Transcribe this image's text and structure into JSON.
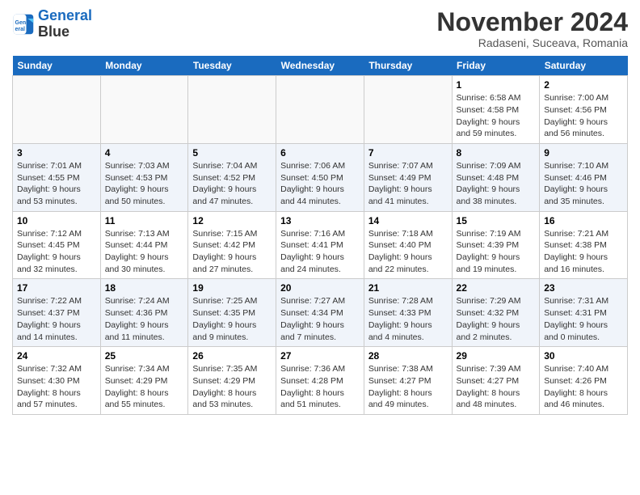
{
  "logo": {
    "line1": "General",
    "line2": "Blue"
  },
  "title": "November 2024",
  "subtitle": "Radaseni, Suceava, Romania",
  "days_of_week": [
    "Sunday",
    "Monday",
    "Tuesday",
    "Wednesday",
    "Thursday",
    "Friday",
    "Saturday"
  ],
  "weeks": [
    [
      {
        "day": "",
        "info": ""
      },
      {
        "day": "",
        "info": ""
      },
      {
        "day": "",
        "info": ""
      },
      {
        "day": "",
        "info": ""
      },
      {
        "day": "",
        "info": ""
      },
      {
        "day": "1",
        "info": "Sunrise: 6:58 AM\nSunset: 4:58 PM\nDaylight: 9 hours and 59 minutes."
      },
      {
        "day": "2",
        "info": "Sunrise: 7:00 AM\nSunset: 4:56 PM\nDaylight: 9 hours and 56 minutes."
      }
    ],
    [
      {
        "day": "3",
        "info": "Sunrise: 7:01 AM\nSunset: 4:55 PM\nDaylight: 9 hours and 53 minutes."
      },
      {
        "day": "4",
        "info": "Sunrise: 7:03 AM\nSunset: 4:53 PM\nDaylight: 9 hours and 50 minutes."
      },
      {
        "day": "5",
        "info": "Sunrise: 7:04 AM\nSunset: 4:52 PM\nDaylight: 9 hours and 47 minutes."
      },
      {
        "day": "6",
        "info": "Sunrise: 7:06 AM\nSunset: 4:50 PM\nDaylight: 9 hours and 44 minutes."
      },
      {
        "day": "7",
        "info": "Sunrise: 7:07 AM\nSunset: 4:49 PM\nDaylight: 9 hours and 41 minutes."
      },
      {
        "day": "8",
        "info": "Sunrise: 7:09 AM\nSunset: 4:48 PM\nDaylight: 9 hours and 38 minutes."
      },
      {
        "day": "9",
        "info": "Sunrise: 7:10 AM\nSunset: 4:46 PM\nDaylight: 9 hours and 35 minutes."
      }
    ],
    [
      {
        "day": "10",
        "info": "Sunrise: 7:12 AM\nSunset: 4:45 PM\nDaylight: 9 hours and 32 minutes."
      },
      {
        "day": "11",
        "info": "Sunrise: 7:13 AM\nSunset: 4:44 PM\nDaylight: 9 hours and 30 minutes."
      },
      {
        "day": "12",
        "info": "Sunrise: 7:15 AM\nSunset: 4:42 PM\nDaylight: 9 hours and 27 minutes."
      },
      {
        "day": "13",
        "info": "Sunrise: 7:16 AM\nSunset: 4:41 PM\nDaylight: 9 hours and 24 minutes."
      },
      {
        "day": "14",
        "info": "Sunrise: 7:18 AM\nSunset: 4:40 PM\nDaylight: 9 hours and 22 minutes."
      },
      {
        "day": "15",
        "info": "Sunrise: 7:19 AM\nSunset: 4:39 PM\nDaylight: 9 hours and 19 minutes."
      },
      {
        "day": "16",
        "info": "Sunrise: 7:21 AM\nSunset: 4:38 PM\nDaylight: 9 hours and 16 minutes."
      }
    ],
    [
      {
        "day": "17",
        "info": "Sunrise: 7:22 AM\nSunset: 4:37 PM\nDaylight: 9 hours and 14 minutes."
      },
      {
        "day": "18",
        "info": "Sunrise: 7:24 AM\nSunset: 4:36 PM\nDaylight: 9 hours and 11 minutes."
      },
      {
        "day": "19",
        "info": "Sunrise: 7:25 AM\nSunset: 4:35 PM\nDaylight: 9 hours and 9 minutes."
      },
      {
        "day": "20",
        "info": "Sunrise: 7:27 AM\nSunset: 4:34 PM\nDaylight: 9 hours and 7 minutes."
      },
      {
        "day": "21",
        "info": "Sunrise: 7:28 AM\nSunset: 4:33 PM\nDaylight: 9 hours and 4 minutes."
      },
      {
        "day": "22",
        "info": "Sunrise: 7:29 AM\nSunset: 4:32 PM\nDaylight: 9 hours and 2 minutes."
      },
      {
        "day": "23",
        "info": "Sunrise: 7:31 AM\nSunset: 4:31 PM\nDaylight: 9 hours and 0 minutes."
      }
    ],
    [
      {
        "day": "24",
        "info": "Sunrise: 7:32 AM\nSunset: 4:30 PM\nDaylight: 8 hours and 57 minutes."
      },
      {
        "day": "25",
        "info": "Sunrise: 7:34 AM\nSunset: 4:29 PM\nDaylight: 8 hours and 55 minutes."
      },
      {
        "day": "26",
        "info": "Sunrise: 7:35 AM\nSunset: 4:29 PM\nDaylight: 8 hours and 53 minutes."
      },
      {
        "day": "27",
        "info": "Sunrise: 7:36 AM\nSunset: 4:28 PM\nDaylight: 8 hours and 51 minutes."
      },
      {
        "day": "28",
        "info": "Sunrise: 7:38 AM\nSunset: 4:27 PM\nDaylight: 8 hours and 49 minutes."
      },
      {
        "day": "29",
        "info": "Sunrise: 7:39 AM\nSunset: 4:27 PM\nDaylight: 8 hours and 48 minutes."
      },
      {
        "day": "30",
        "info": "Sunrise: 7:40 AM\nSunset: 4:26 PM\nDaylight: 8 hours and 46 minutes."
      }
    ]
  ]
}
